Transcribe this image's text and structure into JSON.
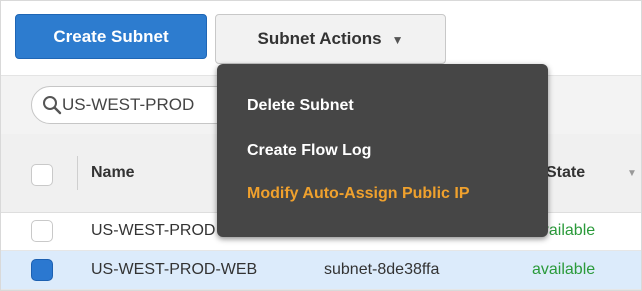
{
  "toolbar": {
    "create_label": "Create Subnet",
    "actions_label": "Subnet Actions",
    "actions_chevron_icon": "chevron-down-icon"
  },
  "search": {
    "icon": "search-icon",
    "value": "US-WEST-PROD"
  },
  "table": {
    "headers": {
      "name": "Name",
      "state": "State"
    },
    "rows": [
      {
        "name": "US-WEST-PROD",
        "subnet_id": "",
        "state": "available",
        "selected": false
      },
      {
        "name": "US-WEST-PROD-WEB",
        "subnet_id": "subnet-8de38ffa",
        "state": "available",
        "selected": true
      }
    ]
  },
  "menu": {
    "items": [
      {
        "label": "Delete Subnet"
      },
      {
        "label": "Create Flow Log"
      },
      {
        "label": "Modify Auto-Assign Public IP",
        "highlight_color": "#f0a12d"
      }
    ]
  },
  "colors": {
    "primary": "#2d7ccf",
    "menu_bg": "#464646",
    "status_ok": "#2a9a3a"
  }
}
